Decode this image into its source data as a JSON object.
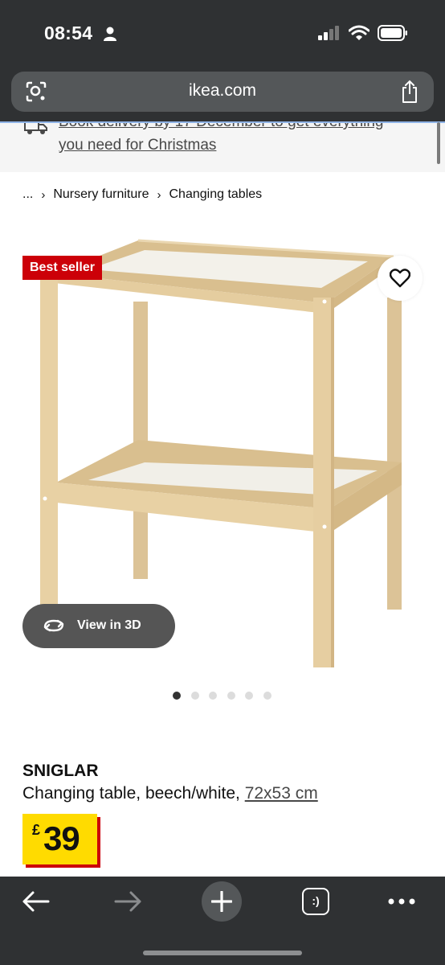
{
  "status_bar": {
    "time": "08:54",
    "icons": [
      "person-icon",
      "signal-icon",
      "wifi-icon",
      "battery-icon"
    ]
  },
  "browser": {
    "url": "ikea.com",
    "icons": [
      "lens-icon",
      "share-icon"
    ]
  },
  "banner": {
    "line1": "Book delivery by 17 December to get everything",
    "line2": "you need for Christmas",
    "icon": "truck-icon"
  },
  "breadcrumb": {
    "items": [
      "...",
      "Nursery furniture",
      "Changing tables"
    ],
    "separator": "›"
  },
  "product": {
    "badge": "Best seller",
    "view_3d_label": "View in 3D",
    "name": "SNIGLAR",
    "description": "Changing table, beech/white, ",
    "dimensions": "72x53 cm",
    "currency": "£",
    "price": "39",
    "carousel": {
      "total": 6,
      "active_index": 0
    }
  },
  "colors": {
    "chrome": "#2f3133",
    "url_bar": "#545759",
    "badge_red": "#cc0008",
    "price_yellow": "#ffdb00",
    "wood": "#e9d3a8"
  },
  "toolbar": {
    "icons": [
      "back-arrow-icon",
      "forward-arrow-icon",
      "plus-icon",
      "tabs-icon",
      "more-icon"
    ],
    "tabs_label": ":)"
  }
}
